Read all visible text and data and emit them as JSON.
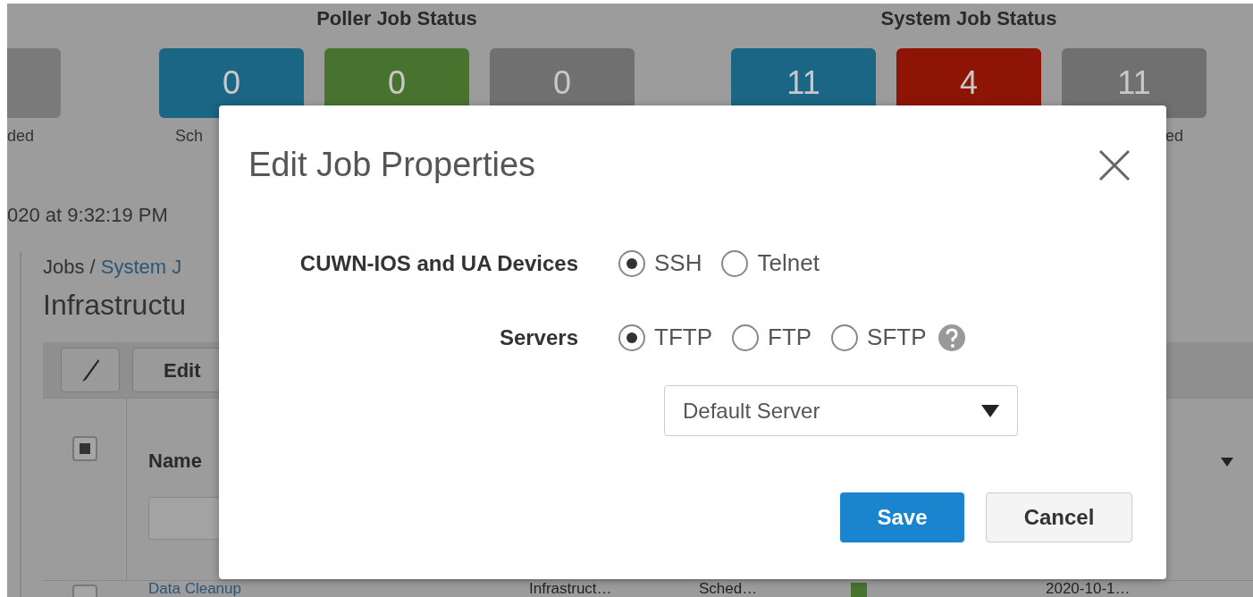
{
  "background": {
    "previous_group": {
      "label": "ded"
    },
    "groups": [
      {
        "title": "Poller Job Status",
        "tiles": [
          {
            "count": "0",
            "color": "#1b6585",
            "label": "Sch"
          },
          {
            "count": "0",
            "color": "#47732f"
          },
          {
            "count": "0",
            "color": "#707070"
          }
        ]
      },
      {
        "title": "System Job Status",
        "tiles": [
          {
            "count": "11",
            "color": "#1b6585"
          },
          {
            "count": "4",
            "color": "#8e1505"
          },
          {
            "count": "11",
            "color": "#707070",
            "label": "ed"
          }
        ]
      }
    ],
    "timestamp": "020 at 9:32:19 PM",
    "breadcrumb": {
      "root": "Jobs /",
      "current": "System J"
    },
    "heading": "Infrastructu",
    "toolbar": {
      "edit_label": "Edit"
    },
    "table": {
      "header_checkbox": {
        "checked": true
      },
      "columns": [
        "Name"
      ],
      "rows": [
        {
          "checked": false,
          "cells": [
            "Data Cleanup",
            "Infrastruct…",
            "Sched…",
            "2020-10-1…"
          ]
        }
      ]
    }
  },
  "dialog": {
    "title": "Edit Job Properties",
    "rows": [
      {
        "label": "CUWN-IOS and UA Devices",
        "options": [
          {
            "label": "SSH",
            "selected": true
          },
          {
            "label": "Telnet",
            "selected": false
          }
        ],
        "help": false
      },
      {
        "label": "Servers",
        "options": [
          {
            "label": "TFTP",
            "selected": true
          },
          {
            "label": "FTP",
            "selected": false
          },
          {
            "label": "SFTP",
            "selected": false
          }
        ],
        "help": true
      }
    ],
    "select": {
      "value": "Default Server"
    },
    "buttons": [
      {
        "label": "Save",
        "kind": "primary"
      },
      {
        "label": "Cancel",
        "kind": "secondary"
      }
    ]
  }
}
